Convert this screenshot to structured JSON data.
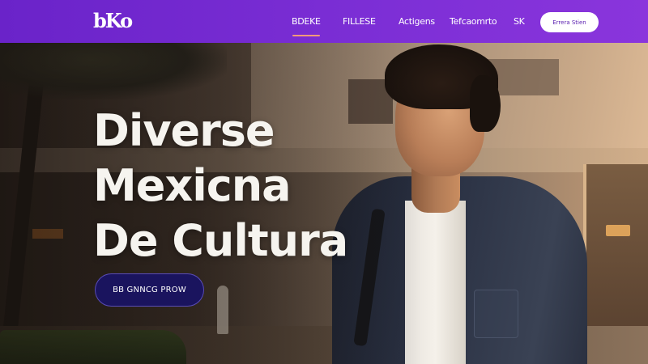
{
  "brand": {
    "logo_text": "bKo"
  },
  "nav": {
    "links": [
      {
        "label": "BDEKE",
        "active": true
      },
      {
        "label": "FILLESE",
        "active": false
      },
      {
        "label": "Actigens",
        "active": false
      },
      {
        "label": "Tefcaomrto",
        "active": false
      },
      {
        "label": "SK",
        "active": false
      }
    ],
    "cta_label": "Errera Stien"
  },
  "hero": {
    "headline_lines": [
      "Diverse",
      "Mexicna",
      "De Cultura"
    ],
    "button_label": "BB GNNCG PROW"
  },
  "colors": {
    "nav_purple": "#7a2dd3",
    "headline_text": "#f6f4ef",
    "hero_button_bg": "#1a145e",
    "active_underline": "#ff9a7a"
  }
}
